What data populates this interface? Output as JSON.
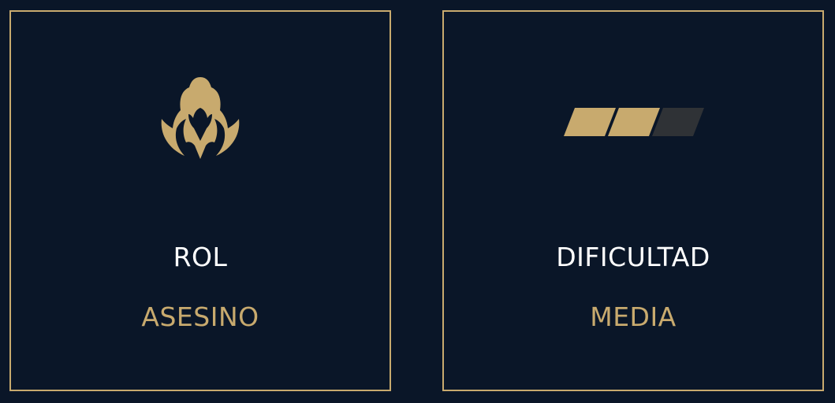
{
  "colors": {
    "background": "#0a1628",
    "accent_gold": "#c8aa6e",
    "title_text": "#ffffff",
    "inactive_segment": "#2f3236"
  },
  "role_card": {
    "icon": "assassin-role-icon",
    "label": "ROL",
    "value": "ASESINO"
  },
  "difficulty_card": {
    "icon": "difficulty-meter-icon",
    "label": "DIFICULTAD",
    "value": "MEDIA",
    "level": 2,
    "max_level": 3
  }
}
